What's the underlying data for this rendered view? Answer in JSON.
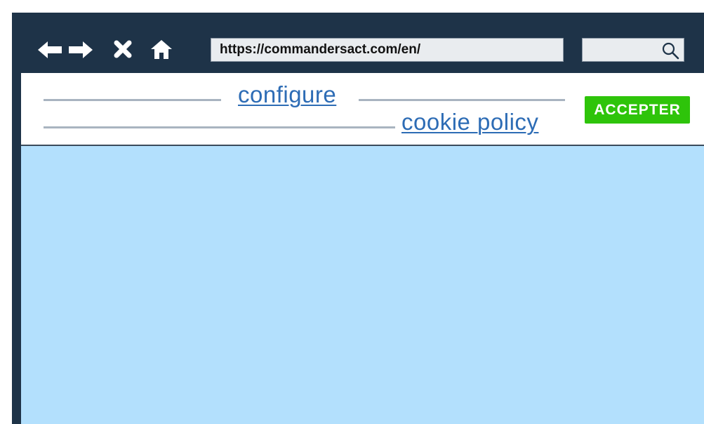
{
  "browser": {
    "url": "https://commandersact.com/en/",
    "nav_icons": [
      "back-arrow-icon",
      "forward-arrow-icon",
      "close-icon",
      "home-icon"
    ],
    "search_icon": "search-icon"
  },
  "cookie_banner": {
    "configure_link": "configure",
    "policy_link": "cookie policy",
    "accept_button": "ACCEPTER"
  },
  "colors": {
    "frame": "#1e3348",
    "content_background": "#b3e0fd",
    "link": "#2d6cb5",
    "accept_button": "#2ec40a"
  }
}
